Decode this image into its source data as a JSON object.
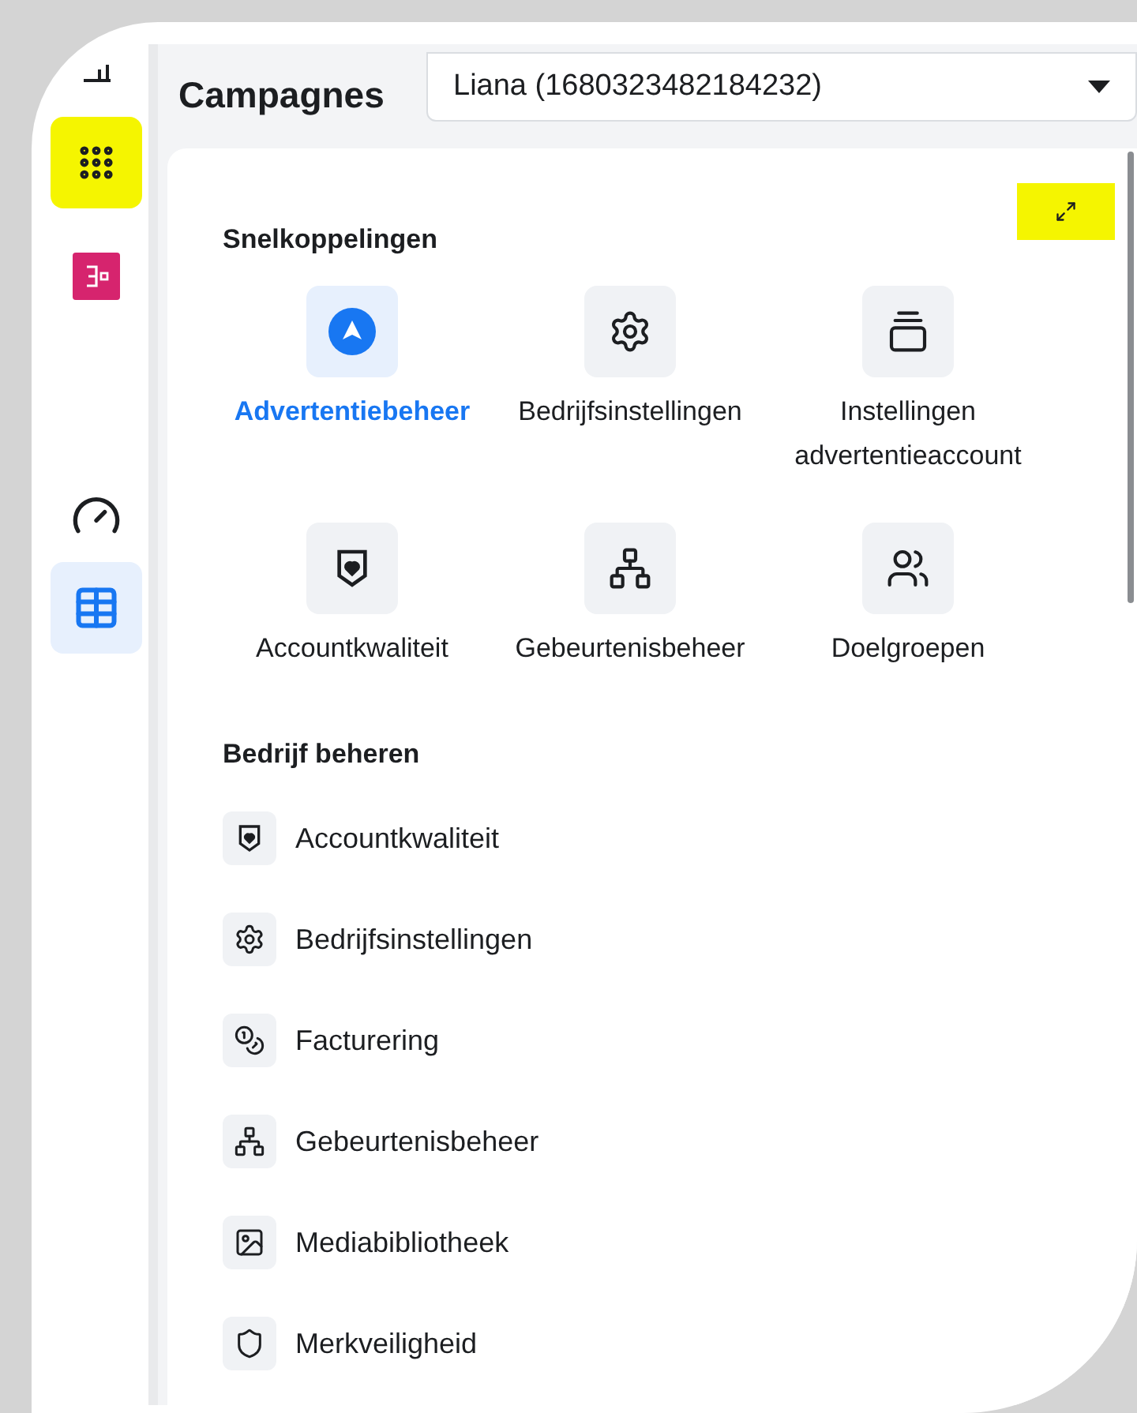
{
  "sidebar": {
    "items": [
      {
        "kind": "chart",
        "selected": false,
        "highlighted": false
      },
      {
        "kind": "apps",
        "selected": false,
        "highlighted": true
      },
      {
        "kind": "logo",
        "selected": false,
        "highlighted": false
      },
      {
        "kind": "gauge",
        "selected": false,
        "highlighted": false
      },
      {
        "kind": "table",
        "selected": true,
        "highlighted": false
      }
    ]
  },
  "header": {
    "title": "Campagnes",
    "account_select": {
      "value": "Liana (1680323482184232)"
    }
  },
  "panel": {
    "expand_highlighted": true,
    "shortcuts": {
      "title": "Snelkoppelingen",
      "items": [
        {
          "kind": "ads",
          "label": "Advertentiebeheer",
          "selected": true
        },
        {
          "kind": "gear",
          "label": "Bedrijfsinstellingen",
          "selected": false
        },
        {
          "kind": "cards",
          "label": "Instellingen advertentieaccount",
          "selected": false
        },
        {
          "kind": "shield-heart",
          "label": "Accountkwaliteit",
          "selected": false
        },
        {
          "kind": "nodes",
          "label": "Gebeurtenisbeheer",
          "selected": false
        },
        {
          "kind": "people",
          "label": "Doelgroepen",
          "selected": false
        }
      ]
    },
    "manage": {
      "title": "Bedrijf beheren",
      "items": [
        {
          "kind": "shield-heart",
          "label": "Accountkwaliteit"
        },
        {
          "kind": "gear",
          "label": "Bedrijfsinstellingen"
        },
        {
          "kind": "coins",
          "label": "Facturering"
        },
        {
          "kind": "nodes",
          "label": "Gebeurtenisbeheer"
        },
        {
          "kind": "image",
          "label": "Mediabibliotheek"
        },
        {
          "kind": "shield",
          "label": "Merkveiligheid"
        }
      ]
    }
  }
}
